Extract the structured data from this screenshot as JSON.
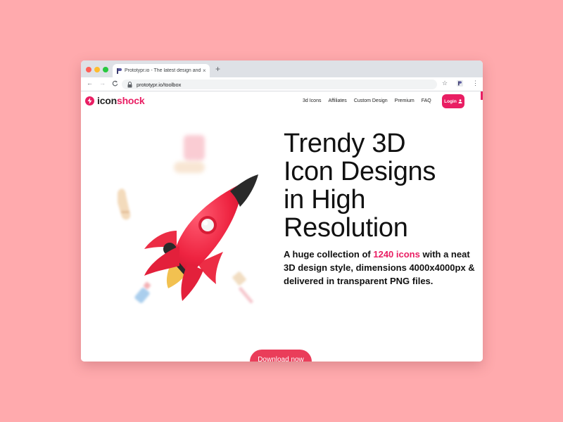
{
  "browser": {
    "tab_title": "Prototypr.io - The latest design and prototyping tools",
    "tab_close": "×",
    "new_tab": "+",
    "url": "prototypr.io/toolbox",
    "back": "←",
    "forward": "→",
    "reload": "C",
    "star": "☆",
    "menu": "⋮"
  },
  "site": {
    "logo_part1": "icon",
    "logo_part2": "shock",
    "nav": [
      "3d Icons",
      "Affiliates",
      "Custom Design",
      "Premium",
      "FAQ"
    ],
    "login_label": "Login"
  },
  "hero": {
    "title_lines": [
      "Trendy 3D",
      "Icon Designs",
      "in High",
      "Resolution"
    ],
    "subtitle_pre": "A huge collection of ",
    "subtitle_highlight": "1240 icons",
    "subtitle_post": " with a neat 3D design style, dimensions 4000x4000px & delivered in transparent PNG files.",
    "cta_label": "Download now"
  },
  "colors": {
    "background": "#ffaaad",
    "brand": "#e91e63",
    "cta": "#ea3d5a"
  }
}
